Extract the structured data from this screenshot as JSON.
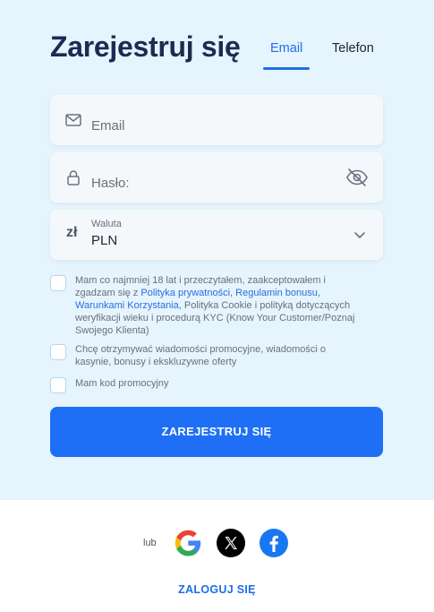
{
  "header": {
    "title": "Zarejestruj się"
  },
  "tabs": [
    {
      "label": "Email",
      "active": true
    },
    {
      "label": "Telefon",
      "active": false
    }
  ],
  "form": {
    "email": {
      "placeholder": "Email",
      "icon": "mail-icon"
    },
    "password": {
      "placeholder": "Hasło:",
      "icon": "lock-icon",
      "toggle_icon": "eye-off-icon"
    },
    "currency": {
      "label": "Waluta",
      "value": "PLN",
      "symbol": "zł"
    }
  },
  "checkboxes": {
    "terms": {
      "text_1": "Mam co najmniej 18 lat i przeczytałem, zaakceptowałem i zgadzam się z ",
      "link_privacy": "Polityka prywatności",
      "sep_1": ", ",
      "link_bonus": "Regulamin bonusu",
      "sep_2": ", ",
      "link_terms": "Warunkami Korzystania",
      "text_2": ", Polityka Cookie i polityką dotyczących weryfikacji wieku i procedurą KYC (Know Your Customer/Poznaj Swojego Klienta)",
      "checked": false
    },
    "promo": {
      "text": "Chcę otrzymywać wiadomości promocyjne, wiadomości o kasynie, bonusy i ekskluzywne oferty",
      "checked": false
    },
    "promo_code": {
      "text": "Mam kod promocyjny",
      "checked": false
    }
  },
  "submit": {
    "label": "ZAREJESTRUJ SIĘ"
  },
  "social": {
    "or_label": "lub",
    "providers": [
      "google",
      "x",
      "facebook"
    ]
  },
  "login": {
    "label": "ZALOGUJ SIĘ"
  },
  "colors": {
    "primary": "#1e6ff5",
    "background_top": "#e5f4fd",
    "title": "#1d2a52"
  }
}
